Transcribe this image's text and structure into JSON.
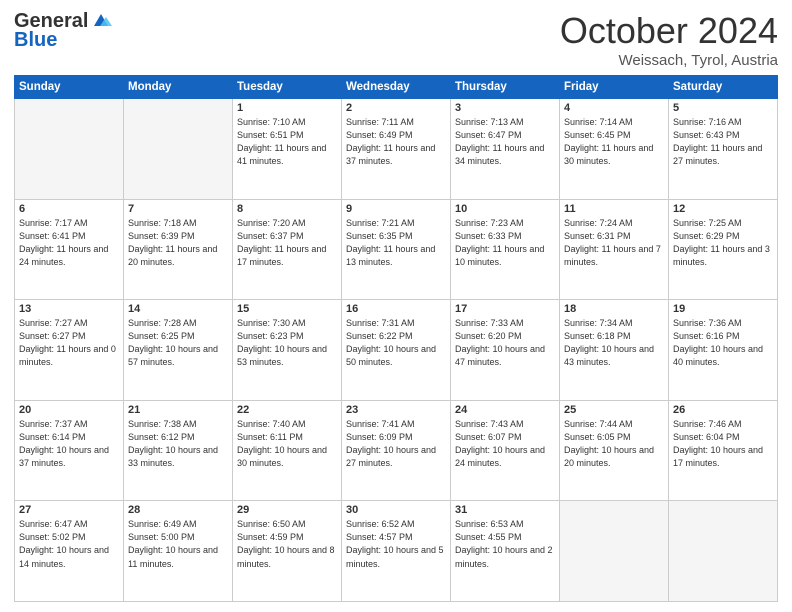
{
  "header": {
    "logo_general": "General",
    "logo_blue": "Blue",
    "title": "October 2024",
    "location": "Weissach, Tyrol, Austria"
  },
  "days_of_week": [
    "Sunday",
    "Monday",
    "Tuesday",
    "Wednesday",
    "Thursday",
    "Friday",
    "Saturday"
  ],
  "weeks": [
    [
      {
        "day": "",
        "empty": true
      },
      {
        "day": "",
        "empty": true
      },
      {
        "day": "1",
        "sunrise": "7:10 AM",
        "sunset": "6:51 PM",
        "daylight": "11 hours and 41 minutes."
      },
      {
        "day": "2",
        "sunrise": "7:11 AM",
        "sunset": "6:49 PM",
        "daylight": "11 hours and 37 minutes."
      },
      {
        "day": "3",
        "sunrise": "7:13 AM",
        "sunset": "6:47 PM",
        "daylight": "11 hours and 34 minutes."
      },
      {
        "day": "4",
        "sunrise": "7:14 AM",
        "sunset": "6:45 PM",
        "daylight": "11 hours and 30 minutes."
      },
      {
        "day": "5",
        "sunrise": "7:16 AM",
        "sunset": "6:43 PM",
        "daylight": "11 hours and 27 minutes."
      }
    ],
    [
      {
        "day": "6",
        "sunrise": "7:17 AM",
        "sunset": "6:41 PM",
        "daylight": "11 hours and 24 minutes."
      },
      {
        "day": "7",
        "sunrise": "7:18 AM",
        "sunset": "6:39 PM",
        "daylight": "11 hours and 20 minutes."
      },
      {
        "day": "8",
        "sunrise": "7:20 AM",
        "sunset": "6:37 PM",
        "daylight": "11 hours and 17 minutes."
      },
      {
        "day": "9",
        "sunrise": "7:21 AM",
        "sunset": "6:35 PM",
        "daylight": "11 hours and 13 minutes."
      },
      {
        "day": "10",
        "sunrise": "7:23 AM",
        "sunset": "6:33 PM",
        "daylight": "11 hours and 10 minutes."
      },
      {
        "day": "11",
        "sunrise": "7:24 AM",
        "sunset": "6:31 PM",
        "daylight": "11 hours and 7 minutes."
      },
      {
        "day": "12",
        "sunrise": "7:25 AM",
        "sunset": "6:29 PM",
        "daylight": "11 hours and 3 minutes."
      }
    ],
    [
      {
        "day": "13",
        "sunrise": "7:27 AM",
        "sunset": "6:27 PM",
        "daylight": "11 hours and 0 minutes."
      },
      {
        "day": "14",
        "sunrise": "7:28 AM",
        "sunset": "6:25 PM",
        "daylight": "10 hours and 57 minutes."
      },
      {
        "day": "15",
        "sunrise": "7:30 AM",
        "sunset": "6:23 PM",
        "daylight": "10 hours and 53 minutes."
      },
      {
        "day": "16",
        "sunrise": "7:31 AM",
        "sunset": "6:22 PM",
        "daylight": "10 hours and 50 minutes."
      },
      {
        "day": "17",
        "sunrise": "7:33 AM",
        "sunset": "6:20 PM",
        "daylight": "10 hours and 47 minutes."
      },
      {
        "day": "18",
        "sunrise": "7:34 AM",
        "sunset": "6:18 PM",
        "daylight": "10 hours and 43 minutes."
      },
      {
        "day": "19",
        "sunrise": "7:36 AM",
        "sunset": "6:16 PM",
        "daylight": "10 hours and 40 minutes."
      }
    ],
    [
      {
        "day": "20",
        "sunrise": "7:37 AM",
        "sunset": "6:14 PM",
        "daylight": "10 hours and 37 minutes."
      },
      {
        "day": "21",
        "sunrise": "7:38 AM",
        "sunset": "6:12 PM",
        "daylight": "10 hours and 33 minutes."
      },
      {
        "day": "22",
        "sunrise": "7:40 AM",
        "sunset": "6:11 PM",
        "daylight": "10 hours and 30 minutes."
      },
      {
        "day": "23",
        "sunrise": "7:41 AM",
        "sunset": "6:09 PM",
        "daylight": "10 hours and 27 minutes."
      },
      {
        "day": "24",
        "sunrise": "7:43 AM",
        "sunset": "6:07 PM",
        "daylight": "10 hours and 24 minutes."
      },
      {
        "day": "25",
        "sunrise": "7:44 AM",
        "sunset": "6:05 PM",
        "daylight": "10 hours and 20 minutes."
      },
      {
        "day": "26",
        "sunrise": "7:46 AM",
        "sunset": "6:04 PM",
        "daylight": "10 hours and 17 minutes."
      }
    ],
    [
      {
        "day": "27",
        "sunrise": "6:47 AM",
        "sunset": "5:02 PM",
        "daylight": "10 hours and 14 minutes."
      },
      {
        "day": "28",
        "sunrise": "6:49 AM",
        "sunset": "5:00 PM",
        "daylight": "10 hours and 11 minutes."
      },
      {
        "day": "29",
        "sunrise": "6:50 AM",
        "sunset": "4:59 PM",
        "daylight": "10 hours and 8 minutes."
      },
      {
        "day": "30",
        "sunrise": "6:52 AM",
        "sunset": "4:57 PM",
        "daylight": "10 hours and 5 minutes."
      },
      {
        "day": "31",
        "sunrise": "6:53 AM",
        "sunset": "4:55 PM",
        "daylight": "10 hours and 2 minutes."
      },
      {
        "day": "",
        "empty": true
      },
      {
        "day": "",
        "empty": true
      }
    ]
  ],
  "labels": {
    "sunrise": "Sunrise:",
    "sunset": "Sunset:",
    "daylight": "Daylight:"
  }
}
